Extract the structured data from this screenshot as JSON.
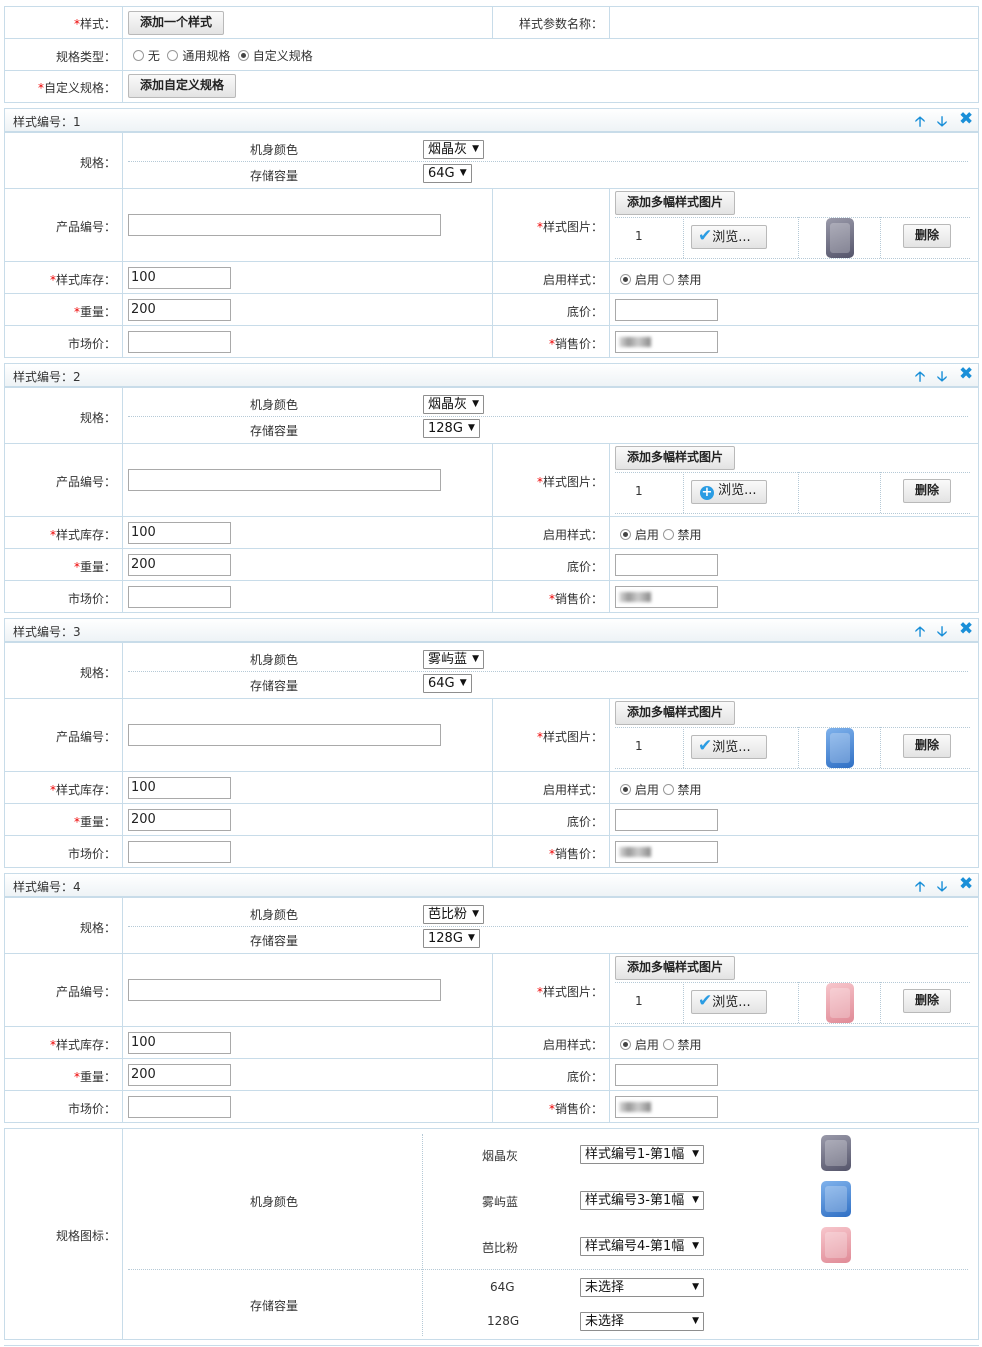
{
  "top": {
    "style_label": "样式：",
    "add_style_button": "添加一个样式",
    "style_param_label": "样式参数名称：",
    "spec_type_label": "规格类型：",
    "spec_opt_none": "无",
    "spec_opt_common": "通用规格",
    "spec_opt_custom": "自定义规格",
    "custom_spec_label": "自定义规格：",
    "add_custom_spec_button": "添加自定义规格"
  },
  "labels": {
    "style_no": "样式编号：",
    "spec": "规格：",
    "color_attr": "机身颜色",
    "storage_attr": "存储容量",
    "product_no": "产品编号：",
    "style_image": "样式图片：",
    "add_images_button": "添加多幅样式图片",
    "browse_button": "浏览...",
    "delete_button": "删除",
    "stock": "样式库存：",
    "enable_style": "启用样式：",
    "enable": "启用",
    "disable": "禁用",
    "weight": "重量：",
    "floor_price": "底价：",
    "market_price": "市场价：",
    "sale_price": "销售价："
  },
  "styles": [
    {
      "no": "1",
      "color": "烟晶灰",
      "storage": "64G",
      "image_index": "1",
      "stock": "100",
      "weight": "200",
      "has_image": true,
      "image_color": "gray"
    },
    {
      "no": "2",
      "color": "烟晶灰",
      "storage": "128G",
      "image_index": "1",
      "stock": "100",
      "weight": "200",
      "has_image": false,
      "image_color": "none"
    },
    {
      "no": "3",
      "color": "雾屿蓝",
      "storage": "64G",
      "image_index": "1",
      "stock": "100",
      "weight": "200",
      "has_image": true,
      "image_color": "blue"
    },
    {
      "no": "4",
      "color": "芭比粉",
      "storage": "128G",
      "image_index": "1",
      "stock": "100",
      "weight": "200",
      "has_image": true,
      "image_color": "pink"
    }
  ],
  "spec_icons": {
    "label": "规格图标：",
    "color_attr": "机身颜色",
    "storage_attr": "存储容量",
    "colors": [
      {
        "name": "烟晶灰",
        "select": "样式编号1-第1幅"
      },
      {
        "name": "雾屿蓝",
        "select": "样式编号3-第1幅"
      },
      {
        "name": "芭比粉",
        "select": "样式编号4-第1幅"
      }
    ],
    "storages": [
      {
        "name": "64G",
        "select": "未选择"
      },
      {
        "name": "128G",
        "select": "未选择"
      }
    ]
  },
  "colors": {
    "border": "#c8dce9",
    "accent": "#1a8fd8",
    "required": "#e00000",
    "phone_gray": "#6e6e80",
    "phone_blue": "#3a7fd0",
    "phone_pink": "#f0a8b0"
  }
}
